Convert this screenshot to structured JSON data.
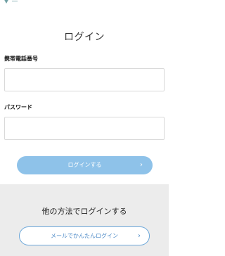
{
  "colors": {
    "primary_button": "#8ec2e9",
    "secondary_border": "#6aa6d9",
    "secondary_text": "#4a88c6",
    "panel_bg": "#ececec"
  },
  "header": {
    "logo_icon": "logo-icon",
    "title": "ログイン"
  },
  "form": {
    "phone_label": "携帯電話番号",
    "phone_value": "",
    "password_label": "パスワード",
    "password_value": "",
    "submit_label": "ログインする",
    "submit_icon": "chevron-right-icon"
  },
  "alternatives": {
    "title": "他の方法でログインする",
    "mail_button_label": "メールでかんたんログイン",
    "mail_button_icon": "chevron-right-icon"
  }
}
